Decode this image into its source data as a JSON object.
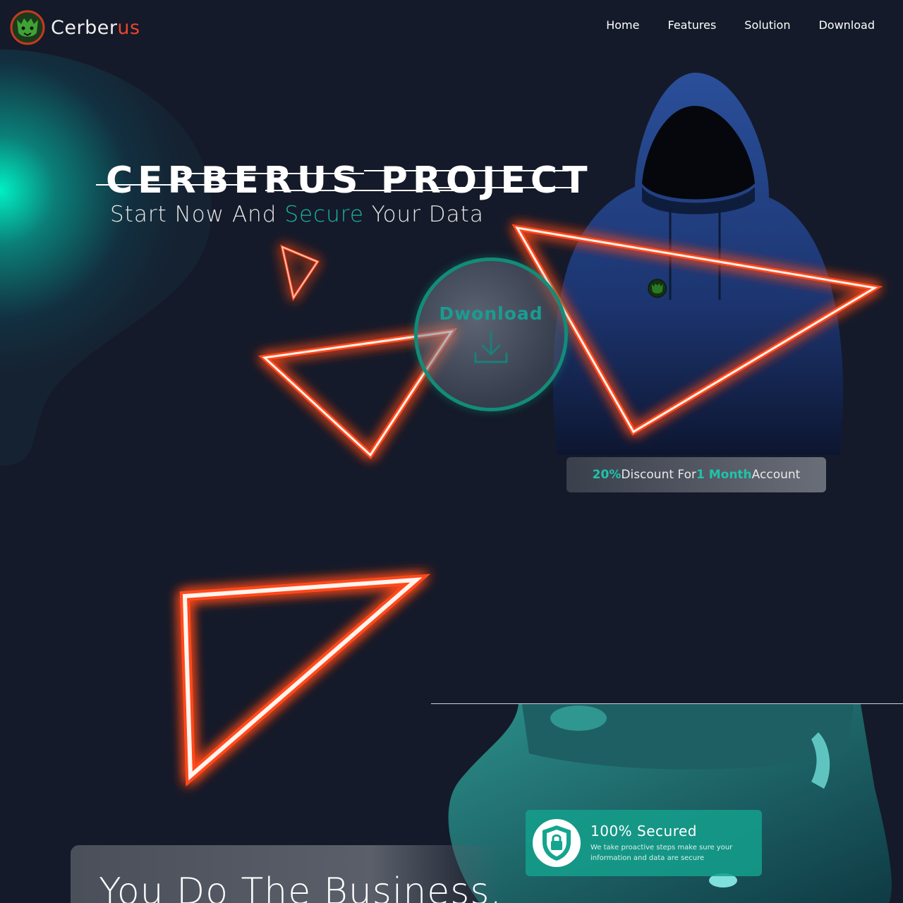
{
  "brand": {
    "name_part1": "Cerber",
    "name_part2": "us",
    "logo_icon": "cerberus-logo-icon"
  },
  "nav": {
    "items": [
      "Home",
      "Features",
      "Solution",
      "Download"
    ]
  },
  "hero": {
    "title": "CERBERUS PROJECT",
    "subtitle_pre": "Start Now And ",
    "subtitle_accent": "Secure",
    "subtitle_post": " Your Data"
  },
  "download_button": {
    "label": "Dwonload",
    "icon": "download-icon"
  },
  "discount": {
    "percent": "20%",
    "text1": " Discount For ",
    "months": "1 Month",
    "text2": " Account"
  },
  "secured": {
    "title": "100% Secured",
    "description": "We take proactive steps make sure your information and data are secure",
    "icon": "shield-lock-icon"
  },
  "business": {
    "title": "You Do The Business,"
  },
  "colors": {
    "background": "#141a29",
    "accent_teal": "#1ab4a0",
    "accent_red": "#e8452a",
    "neon_orange": "#ff4a1c"
  }
}
